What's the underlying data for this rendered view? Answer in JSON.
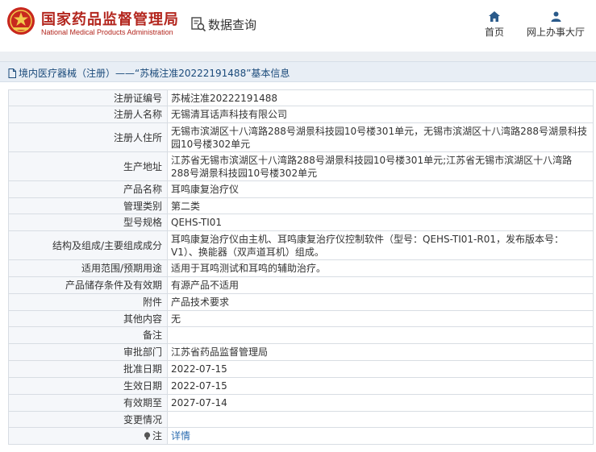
{
  "header": {
    "site_title": "国家药品监督管理局",
    "site_subtitle": "National Medical Products Administration",
    "page_label": "数据查询",
    "nav": [
      {
        "label": "首页",
        "icon": "home-icon"
      },
      {
        "label": "网上办事大厅",
        "icon": "user-icon"
      }
    ]
  },
  "breadcrumb": "境内医疗器械（注册）——“苏械注准20222191488”基本信息",
  "colors": {
    "brand_red": "#b3261e",
    "link_blue": "#2b6cb0",
    "breadcrumb_bg": "#e8eef5"
  },
  "fields": [
    {
      "label": "注册证编号",
      "value": "苏械注准20222191488"
    },
    {
      "label": "注册人名称",
      "value": "无锡清耳话声科技有限公司"
    },
    {
      "label": "注册人住所",
      "value": "无锡市滨湖区十八湾路288号湖景科技园10号楼301单元，无锡市滨湖区十八湾路288号湖景科技园10号楼302单元"
    },
    {
      "label": "生产地址",
      "value": "江苏省无锡市滨湖区十八湾路288号湖景科技园10号楼301单元;江苏省无锡市滨湖区十八湾路288号湖景科技园10号楼302单元"
    },
    {
      "label": "产品名称",
      "value": "耳鸣康复治疗仪"
    },
    {
      "label": "管理类别",
      "value": "第二类"
    },
    {
      "label": "型号规格",
      "value": "QEHS-TI01"
    },
    {
      "label": "结构及组成/主要组成成分",
      "value": "耳鸣康复治疗仪由主机、耳鸣康复治疗仪控制软件（型号：QEHS-TI01-R01，发布版本号：V1）、换能器（双声道耳机）组成。"
    },
    {
      "label": "适用范围/预期用途",
      "value": "适用于耳鸣测试和耳鸣的辅助治疗。"
    },
    {
      "label": "产品储存条件及有效期",
      "value": "有源产品不适用"
    },
    {
      "label": "附件",
      "value": "产品技术要求"
    },
    {
      "label": "其他内容",
      "value": "无"
    },
    {
      "label": "备注",
      "value": ""
    },
    {
      "label": "审批部门",
      "value": "江苏省药品监督管理局"
    },
    {
      "label": "批准日期",
      "value": "2022-07-15"
    },
    {
      "label": "生效日期",
      "value": "2022-07-15"
    },
    {
      "label": "有效期至",
      "value": "2027-07-14"
    },
    {
      "label": "变更情况",
      "value": ""
    }
  ],
  "note": {
    "label": "注",
    "link": "详情",
    "icon": "bulb-icon"
  }
}
